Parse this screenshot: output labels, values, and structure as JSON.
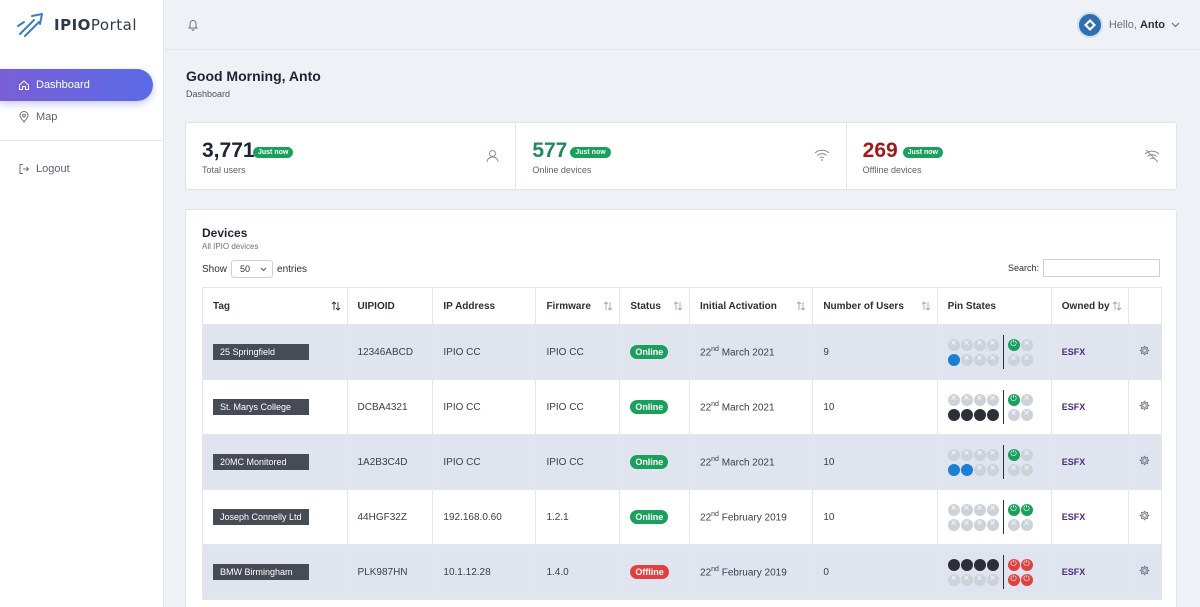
{
  "app": {
    "name_bold": "IPIO",
    "name_thin": "Portal"
  },
  "sidebar": {
    "items": [
      {
        "label": "Dashboard",
        "icon": "home-icon"
      },
      {
        "label": "Map",
        "icon": "location-pin-icon"
      },
      {
        "label": "Logout",
        "icon": "logout-icon"
      }
    ]
  },
  "topbar": {
    "greeting_prefix": "Hello,",
    "user": "Anto"
  },
  "page": {
    "title": "Good Morning, Anto",
    "breadcrumb": "Dashboard"
  },
  "stats": [
    {
      "value": "3,771",
      "badge": "Just now",
      "label": "Total users",
      "icon": "user-icon"
    },
    {
      "value": "577",
      "badge": "Just now",
      "label": "Online devices",
      "icon": "wifi-icon"
    },
    {
      "value": "269",
      "badge": "Just now",
      "label": "Offline devices",
      "icon": "wifi-off-icon"
    }
  ],
  "devices": {
    "title": "Devices",
    "subtitle": "All IPIO devices",
    "show_label": "Show",
    "entries_value": "50",
    "entries_label": "entries",
    "search_label": "Search:",
    "columns": [
      "Tag",
      "UIPIOID",
      "IP Address",
      "Firmware",
      "Status",
      "Initial Activation",
      "Number of Users",
      "Pin States",
      "Owned by"
    ],
    "rows": [
      {
        "tag": "25 Springfield",
        "uid": "12346ABCD",
        "ip": "IPIO CC",
        "fw": "IPIO CC",
        "status": "Online",
        "act_day": "22",
        "act_sup": "nd",
        "act_rest": " March 2021",
        "users": "9",
        "owner": "ESFX"
      },
      {
        "tag": "St. Marys College",
        "uid": "DCBA4321",
        "ip": "IPIO CC",
        "fw": "IPIO CC",
        "status": "Online",
        "act_day": "22",
        "act_sup": "nd",
        "act_rest": " March 2021",
        "users": "10",
        "owner": "ESFX"
      },
      {
        "tag": "20MC Monitored",
        "uid": "1A2B3C4D",
        "ip": "IPIO CC",
        "fw": "IPIO CC",
        "status": "Online",
        "act_day": "22",
        "act_sup": "nd",
        "act_rest": " March 2021",
        "users": "10",
        "owner": "ESFX"
      },
      {
        "tag": "Joseph Connelly Ltd",
        "uid": "44HGF32Z",
        "ip": "192.168.0.60",
        "fw": "1.2.1",
        "status": "Online",
        "act_day": "22",
        "act_sup": "nd",
        "act_rest": " February 2019",
        "users": "10",
        "owner": "ESFX"
      },
      {
        "tag": "BMW Birmingham",
        "uid": "PLK987HN",
        "ip": "10.1.12.28",
        "fw": "1.4.0",
        "status": "Offline",
        "act_day": "22",
        "act_sup": "nd",
        "act_rest": " February 2019",
        "users": "0",
        "owner": "ESFX"
      }
    ]
  },
  "colors": {
    "accent": "#5a6ae6",
    "online": "#1a9f5c",
    "offline": "#e04040",
    "pin_blue": "#1b7fd6"
  }
}
